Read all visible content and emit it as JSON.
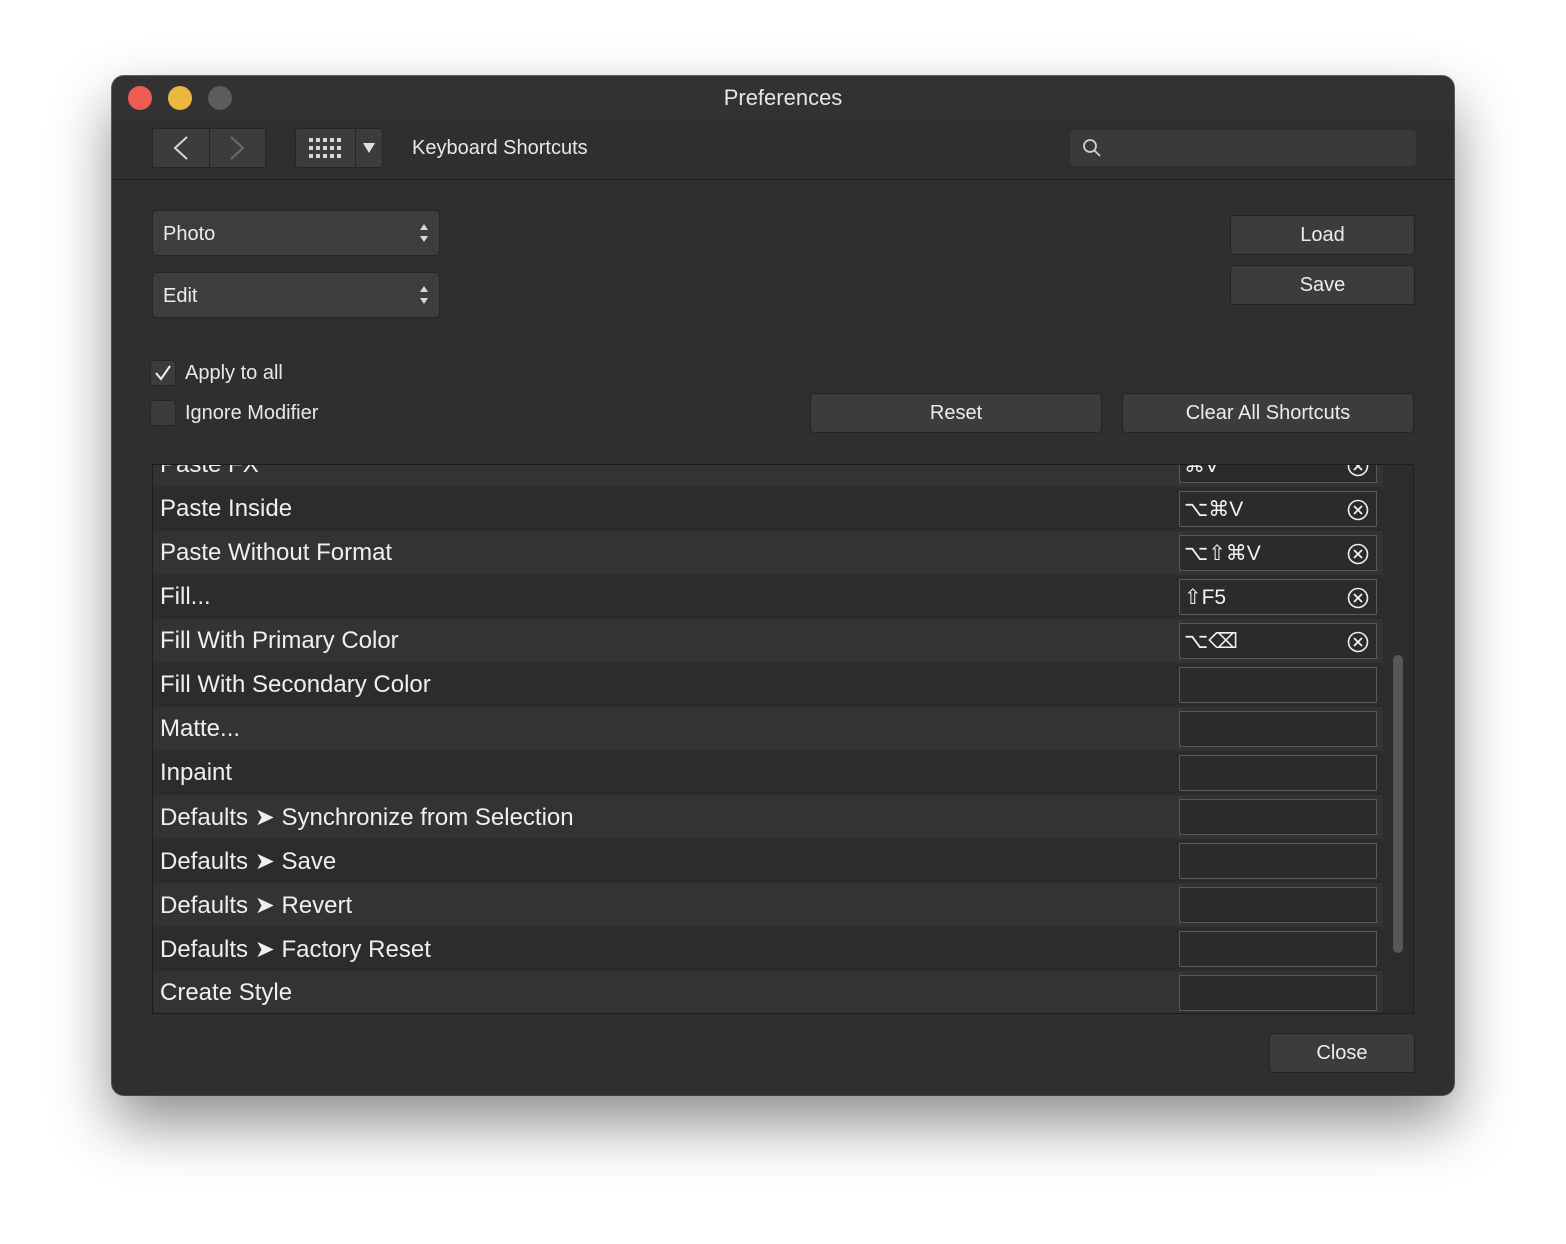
{
  "window": {
    "title": "Preferences"
  },
  "toolbar": {
    "section_title": "Keyboard Shortcuts",
    "search_placeholder": ""
  },
  "selectors": {
    "app": "Photo",
    "category": "Edit"
  },
  "buttons": {
    "load": "Load",
    "save": "Save",
    "reset": "Reset",
    "clear_all": "Clear All Shortcuts",
    "close": "Close"
  },
  "options": {
    "apply_to_all": {
      "label": "Apply to all",
      "checked": true
    },
    "ignore_modifier": {
      "label": "Ignore Modifier",
      "checked": false
    }
  },
  "shortcuts": [
    {
      "name": "Paste FX",
      "keys": "⌘V"
    },
    {
      "name": "Paste Inside",
      "keys": "⌥⌘V"
    },
    {
      "name": "Paste Without Format",
      "keys": "⌥⇧⌘V"
    },
    {
      "name": "Fill...",
      "keys": "⇧F5"
    },
    {
      "name": "Fill With Primary Color",
      "keys": "⌥⌫"
    },
    {
      "name": "Fill With Secondary Color",
      "keys": ""
    },
    {
      "name": "Matte...",
      "keys": ""
    },
    {
      "name": "Inpaint",
      "keys": ""
    },
    {
      "name": "Defaults ➤ Synchronize from Selection",
      "keys": ""
    },
    {
      "name": "Defaults ➤ Save",
      "keys": ""
    },
    {
      "name": "Defaults ➤ Revert",
      "keys": ""
    },
    {
      "name": "Defaults ➤ Factory Reset",
      "keys": ""
    },
    {
      "name": "Create Style",
      "keys": ""
    }
  ],
  "colors": {
    "window_bg": "#2f2f2f",
    "close_light": "#ee5b52",
    "minimize_light": "#e9b73e",
    "zoom_light": "#5c5c5c"
  }
}
